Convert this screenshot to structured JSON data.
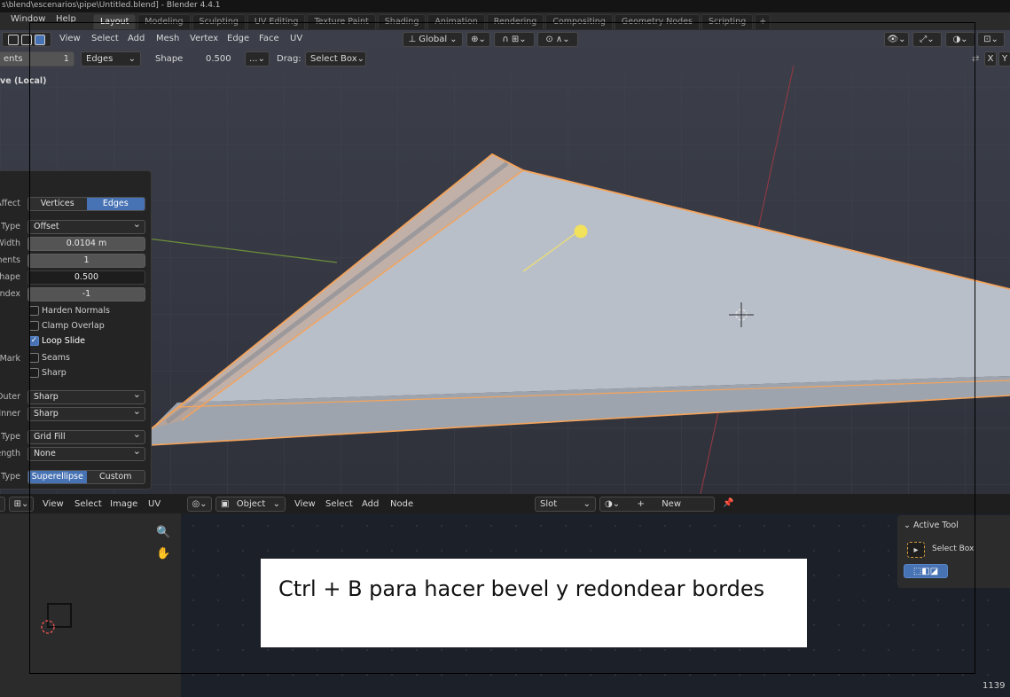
{
  "window": {
    "title": "s\\blend\\escenarios\\pipe\\Untitled.blend] - Blender 4.4.1",
    "menus": [
      "Window",
      "Help"
    ]
  },
  "workspace_tabs": [
    "Layout",
    "Modeling",
    "Sculpting",
    "UV Editing",
    "Texture Paint",
    "Shading",
    "Animation",
    "Rendering",
    "Compositing",
    "Geometry Nodes",
    "Scripting",
    "+"
  ],
  "viewport_header": {
    "menus": [
      "View",
      "Select",
      "Add",
      "Mesh",
      "Vertex",
      "Edge",
      "Face",
      "UV"
    ],
    "transform_orientation": "Global"
  },
  "tool_settings": {
    "segments_label": "ents",
    "segments_value": "1",
    "affect_value": "Edges",
    "shape_label": "Shape",
    "shape_value": "0.500",
    "more_button": "...",
    "drag_label": "Drag:",
    "drag_value": "Select Box",
    "axes": [
      "X",
      "Y"
    ]
  },
  "viewport_label": "ve (Local)",
  "bevel_panel": {
    "affect_label": "Affect",
    "affect_options": [
      "Vertices",
      "Edges"
    ],
    "affect_selected": "Edges",
    "width_type_label": "Type",
    "width_type_value": "Offset",
    "width_label": "Width",
    "width_value": "0.0104 m",
    "segments_label": "nents",
    "segments_value": "1",
    "shape_label": "Shape",
    "shape_value": "0.500",
    "material_index_label": "Index",
    "material_index_value": "-1",
    "harden_normals": {
      "label": "Harden Normals",
      "checked": false
    },
    "clamp_overlap": {
      "label": "Clamp Overlap",
      "checked": false
    },
    "loop_slide": {
      "label": "Loop Slide",
      "checked": true
    },
    "mark_label": "Mark",
    "mark_seams": {
      "label": "Seams",
      "checked": false
    },
    "mark_sharp": {
      "label": "Sharp",
      "checked": false
    },
    "outer_label": "Outer",
    "outer_value": "Sharp",
    "inner_label": "Inner",
    "inner_value": "Sharp",
    "intersection_type_label": "Type",
    "intersection_type_value": "Grid Fill",
    "face_strength_label": "ength",
    "face_strength_value": "None",
    "profile_type_label": "Type",
    "profile_options": [
      "Superellipse",
      "Custom"
    ],
    "profile_selected": "Superellipse"
  },
  "uv_editor_header": {
    "menus": [
      "View",
      "Select",
      "Image",
      "UV"
    ]
  },
  "shader_header": {
    "object_value": "Object",
    "menus": [
      "View",
      "Select",
      "Add",
      "Node"
    ],
    "slot_value": "Slot",
    "new_button": "New"
  },
  "active_tool": {
    "title": "Active Tool",
    "tool_name": "Select Box"
  },
  "caption": {
    "text": "Ctrl + B para hacer bevel y redondear bordes"
  },
  "corner_number": "1139",
  "colors": {
    "accent": "#4772b3",
    "selection_orange": "#f5a35a",
    "light_yellow": "#f2e15a",
    "viewport_bg": "#383b46"
  }
}
